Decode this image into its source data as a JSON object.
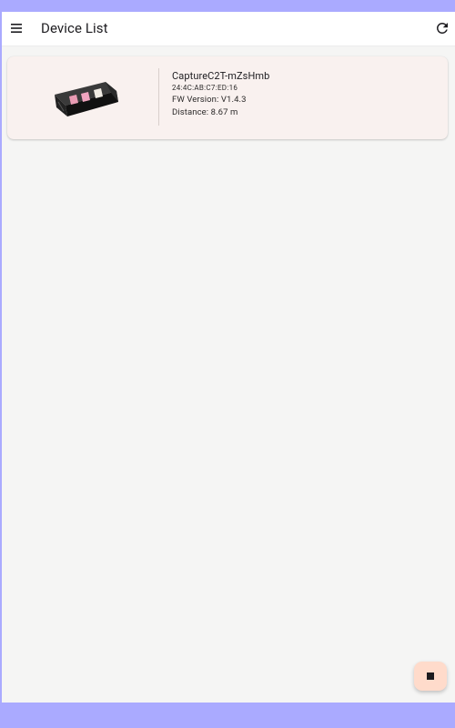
{
  "app_bar": {
    "title": "Device List",
    "menu_icon": "menu-icon",
    "refresh_icon": "refresh-icon"
  },
  "devices": [
    {
      "name": "CaptureC2T-mZsHmb",
      "mac": "24:4C:AB:C7:ED:16",
      "firmware": "FW Version: V1.4.3",
      "distance": "Distance: 8.67 m",
      "image_icon": "device-image-icon"
    }
  ],
  "fab": {
    "icon": "stop-icon",
    "color": "#ffdbcb"
  },
  "colors": {
    "system_bar": "#aaaaff",
    "background": "#f5f5f4",
    "card": "#f9f1ef"
  }
}
